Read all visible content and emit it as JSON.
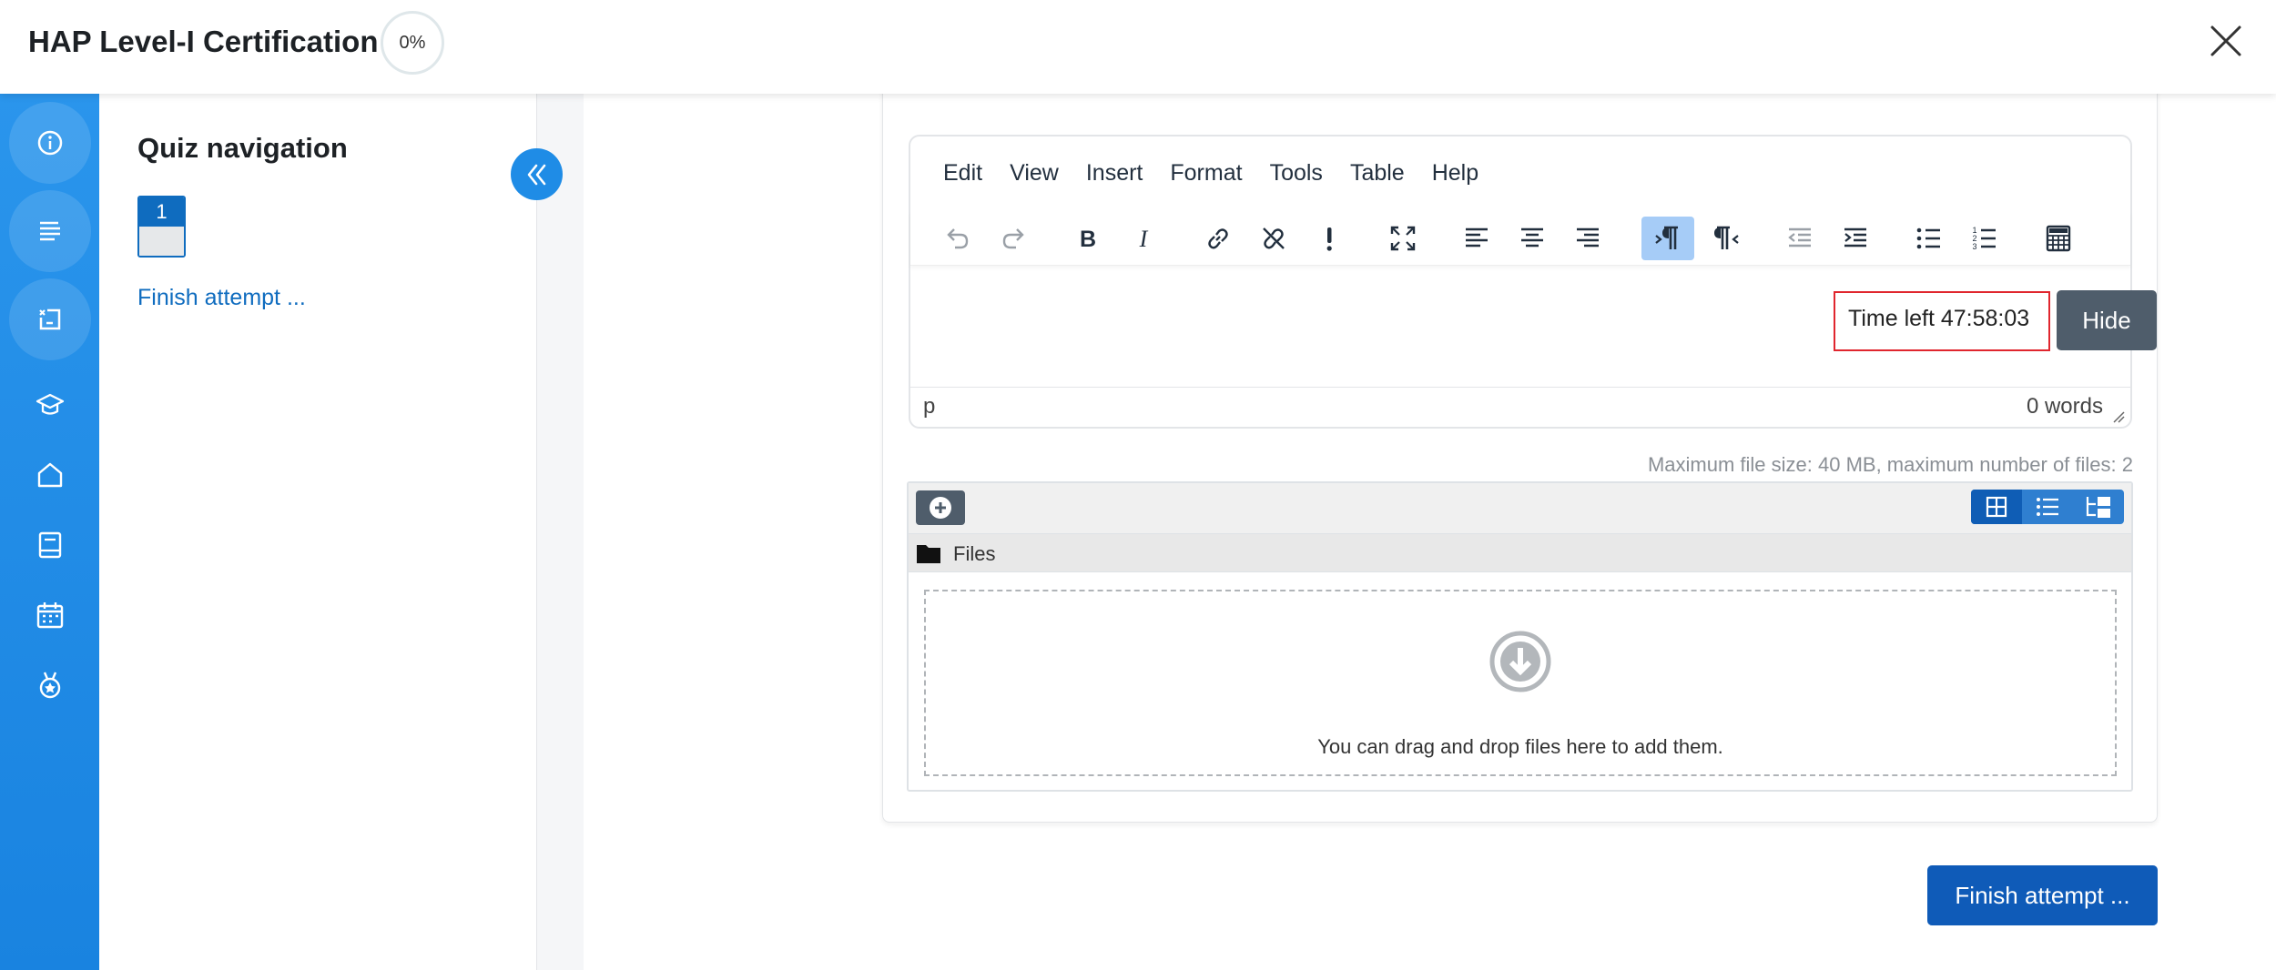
{
  "header": {
    "course_title": "HAP Level-I Certification",
    "progress": "0%",
    "close_icon": "close-icon"
  },
  "rail": {
    "icons": [
      "info-icon",
      "text-lines-icon",
      "quiz-icon",
      "graduation-cap-icon",
      "home-icon",
      "book-icon",
      "calendar-icon",
      "badge-icon"
    ],
    "active_index": 2
  },
  "drawer": {
    "title": "Quiz navigation",
    "question_number": "1",
    "finish_link": "Finish attempt ..."
  },
  "editor": {
    "menu": [
      "Edit",
      "View",
      "Insert",
      "Format",
      "Tools",
      "Table",
      "Help"
    ],
    "toolbar_icons": [
      "undo-icon",
      "redo-icon",
      "bold-icon",
      "italic-icon",
      "link-icon",
      "unlink-icon",
      "exclamation-icon",
      "fullscreen-icon",
      "align-left-icon",
      "align-center-icon",
      "align-right-icon",
      "ltr-icon",
      "rtl-icon",
      "outdent-icon",
      "indent-icon",
      "bullet-list-icon",
      "numbered-list-icon",
      "calculator-icon"
    ],
    "status_path": "p",
    "word_count": "0 words"
  },
  "timer": {
    "text": "Time left 47:58:03",
    "hide_label": "Hide"
  },
  "filemanager": {
    "info": "Maximum file size: 40 MB, maximum number of files: 2",
    "path_label": "Files",
    "drop_text": "You can drag and drop files here to add them."
  },
  "finish_button": "Finish attempt ...",
  "colors": {
    "rail": "#1f8ce6",
    "primary": "#0f6cbf",
    "timer_border": "#e0262e",
    "hide_button": "#4f5d6b"
  }
}
